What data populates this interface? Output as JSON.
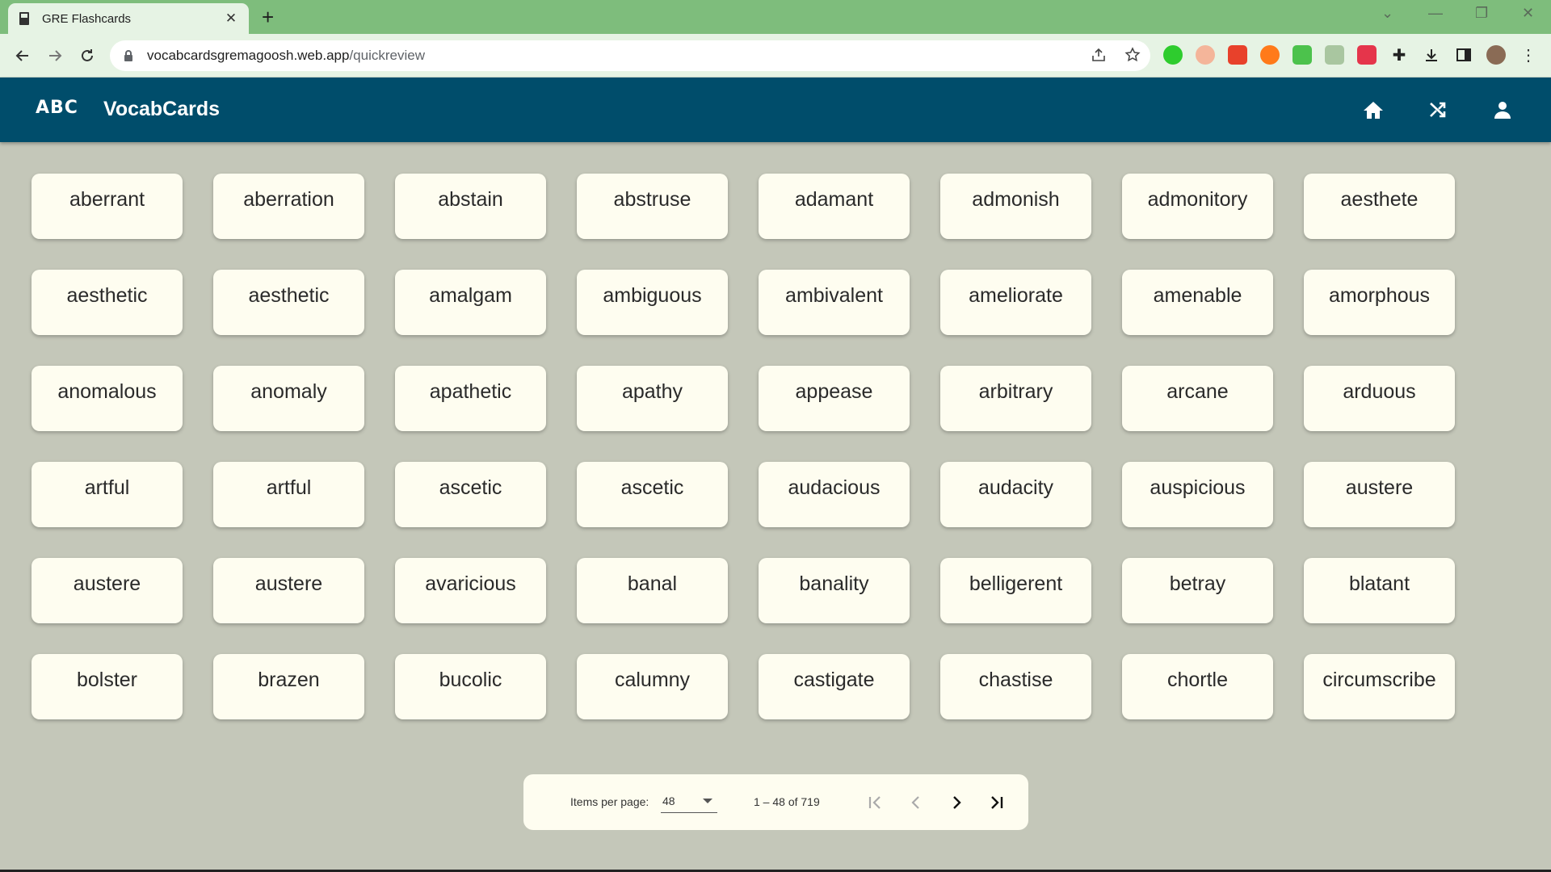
{
  "browser": {
    "tab_title": "GRE Flashcards",
    "url_host": "vocabcardsgremagoosh.web.app",
    "url_path": "/quickreview"
  },
  "app": {
    "logo": "ABC",
    "title": "VocabCards"
  },
  "cards": [
    "aberrant",
    "aberration",
    "abstain",
    "abstruse",
    "adamant",
    "admonish",
    "admonitory",
    "aesthete",
    "aesthetic",
    "aesthetic",
    "amalgam",
    "ambiguous",
    "ambivalent",
    "ameliorate",
    "amenable",
    "amorphous",
    "anomalous",
    "anomaly",
    "apathetic",
    "apathy",
    "appease",
    "arbitrary",
    "arcane",
    "arduous",
    "artful",
    "artful",
    "ascetic",
    "ascetic",
    "audacious",
    "audacity",
    "auspicious",
    "austere",
    "austere",
    "austere",
    "avaricious",
    "banal",
    "banality",
    "belligerent",
    "betray",
    "blatant",
    "bolster",
    "brazen",
    "bucolic",
    "calumny",
    "castigate",
    "chastise",
    "chortle",
    "circumscribe"
  ],
  "paginator": {
    "items_per_page_label": "Items per page:",
    "items_per_page_value": "48",
    "range_label": "1 – 48 of 719"
  },
  "colors": {
    "header": "#004d6b",
    "background": "#c4c7b9",
    "card": "#fefdf0",
    "tab_strip": "#7ebd7c"
  }
}
